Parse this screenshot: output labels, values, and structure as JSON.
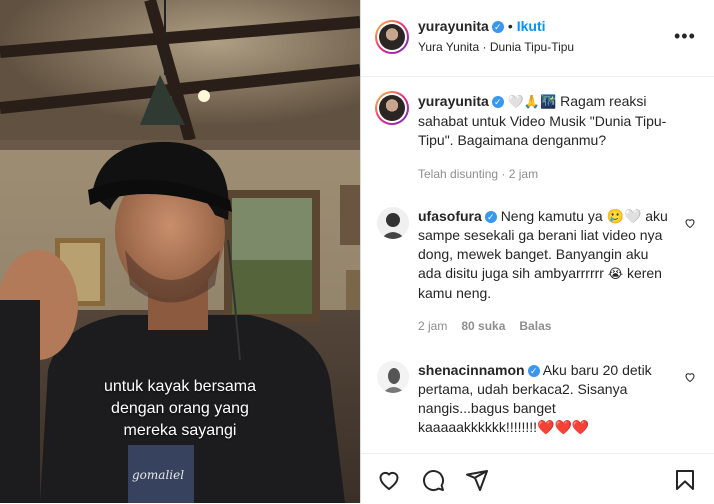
{
  "header": {
    "username": "yurayunita",
    "follow_label": "Ikuti",
    "subtitle": "Yura Yunita · Dunia Tipu-Tipu",
    "more_icon": "more-icon"
  },
  "media": {
    "caption_lines": [
      "untuk kayak bersama",
      "dengan orang yang",
      "mereka sayangi"
    ],
    "shirt_text": "gomaliel"
  },
  "post": {
    "username": "yurayunita",
    "emojis": "🤍🙏🌃",
    "text": "Ragam reaksi sahabat untuk Video Musik \"Dunia Tipu-Tipu\". Bagaimana denganmu?",
    "meta": "Telah disunting · 2 jam"
  },
  "comments": [
    {
      "username": "ufasofura",
      "text_before": "Neng kamutu ya 🥲🤍 aku sampe sesekali ga berani liat video nya dong, mewek banget. Banyangin aku ada disitu juga sih ambyarrrrrr",
      "text_after": " keren kamu neng.",
      "emoji": "😭",
      "time": "2 jam",
      "likes": "80 suka",
      "reply": "Balas"
    },
    {
      "username": "shenacinnamon",
      "text_before": "Aku baru 20 detik pertama, udah berkaca2. Sisanya nangis...bagus banget kaaaaakkkkkk!!!!!!!!",
      "text_after": "",
      "emoji": "❤️❤️❤️",
      "time": "",
      "likes": "",
      "reply": ""
    }
  ],
  "actions": {
    "like": "heart-icon",
    "comment": "comment-icon",
    "share": "share-icon",
    "save": "bookmark-icon"
  },
  "colors": {
    "link_blue": "#0095f6",
    "verified_blue": "#3897f0",
    "muted": "#8e8e8e"
  }
}
